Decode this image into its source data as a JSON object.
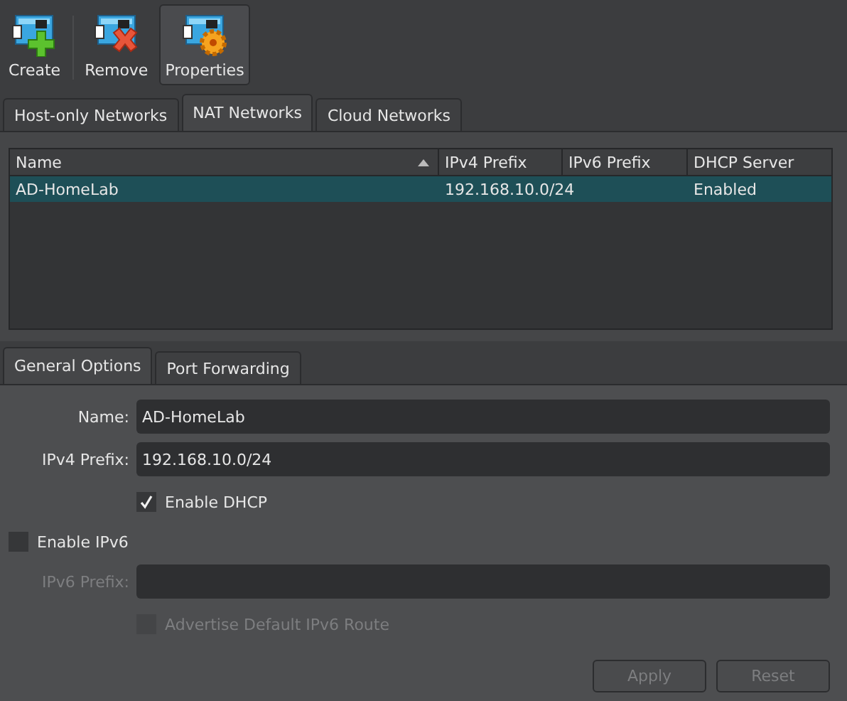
{
  "toolbar": [
    {
      "label": "Create",
      "kind": "create",
      "selected": false
    },
    {
      "label": "Remove",
      "kind": "remove",
      "selected": false
    },
    {
      "label": "Properties",
      "kind": "properties",
      "selected": true
    }
  ],
  "network_tabs": [
    {
      "label": "Host-only Networks",
      "selected": false
    },
    {
      "label": "NAT Networks",
      "selected": true
    },
    {
      "label": "Cloud Networks",
      "selected": false
    }
  ],
  "table": {
    "columns": [
      {
        "label": "Name",
        "sorted": true
      },
      {
        "label": "IPv4 Prefix",
        "sorted": false
      },
      {
        "label": "IPv6 Prefix",
        "sorted": false
      },
      {
        "label": "DHCP Server",
        "sorted": false
      }
    ],
    "rows": [
      {
        "cells": [
          "AD-HomeLab",
          "192.168.10.0/24",
          "",
          "Enabled"
        ],
        "selected": true
      }
    ]
  },
  "detail_tabs": [
    {
      "label": "General Options",
      "selected": true
    },
    {
      "label": "Port Forwarding",
      "selected": false
    }
  ],
  "form": {
    "name": {
      "label": "Name:",
      "value": "AD-HomeLab"
    },
    "ipv4_prefix": {
      "label": "IPv4 Prefix:",
      "value": "192.168.10.0/24"
    },
    "enable_dhcp": {
      "label": "Enable DHCP",
      "checked": true,
      "disabled": false
    },
    "enable_ipv6": {
      "label": "Enable IPv6",
      "checked": false,
      "disabled": false
    },
    "ipv6_prefix": {
      "label": "IPv6 Prefix:",
      "disabled": true
    },
    "advertise_route": {
      "label": "Advertise Default IPv6 Route",
      "checked": false,
      "disabled": true
    }
  },
  "buttons": [
    {
      "label": "Apply",
      "disabled": true
    },
    {
      "label": "Reset",
      "disabled": true
    }
  ]
}
